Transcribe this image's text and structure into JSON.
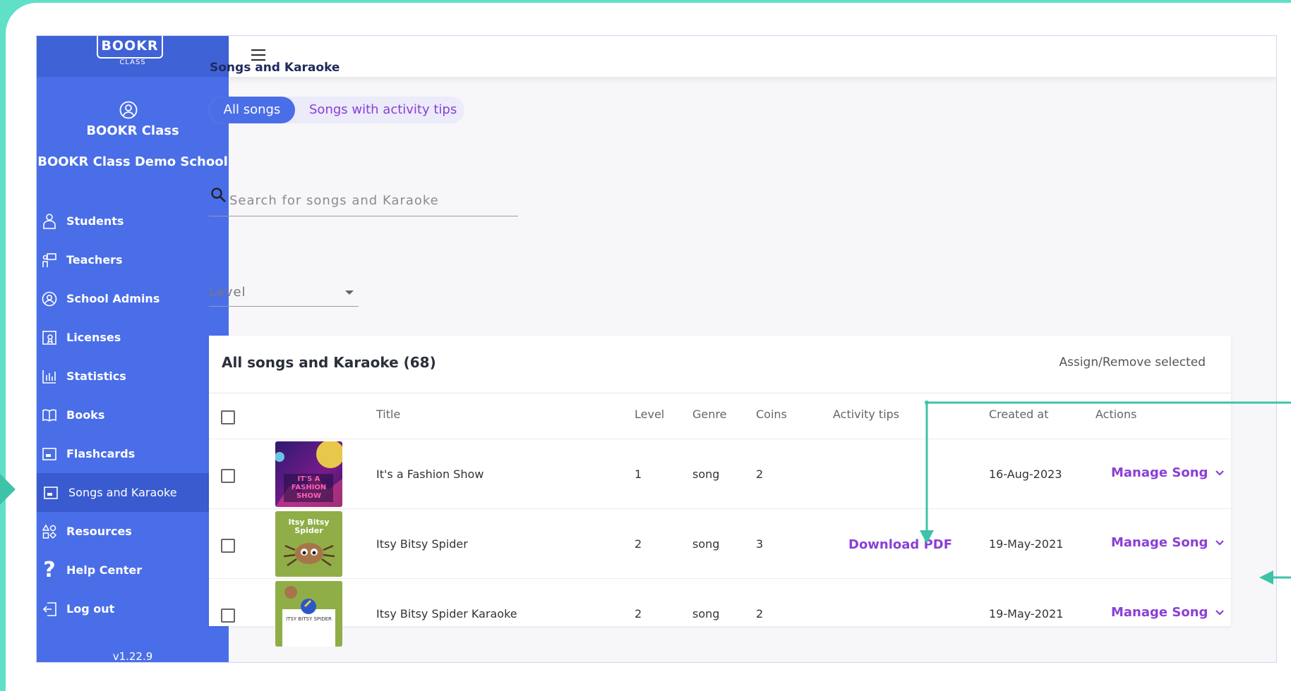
{
  "sidebar": {
    "logo": "BOOKR",
    "logo_sub": "CLASS",
    "user_name": "BOOKR Class",
    "school_name": "BOOKR Class Demo School",
    "items": [
      {
        "label": "Students",
        "icon": "students-icon"
      },
      {
        "label": "Teachers",
        "icon": "teachers-icon"
      },
      {
        "label": "School Admins",
        "icon": "admin-icon"
      },
      {
        "label": "Licenses",
        "icon": "license-icon"
      },
      {
        "label": "Statistics",
        "icon": "statistics-icon"
      },
      {
        "label": "Books",
        "icon": "book-icon"
      },
      {
        "label": "Flashcards",
        "icon": "flashcards-icon"
      },
      {
        "label": "Songs and Karaoke",
        "icon": "songs-icon"
      },
      {
        "label": "Resources",
        "icon": "resources-icon"
      },
      {
        "label": "Help Center",
        "icon": "help-icon"
      },
      {
        "label": "Log out",
        "icon": "logout-icon"
      }
    ],
    "active_index": 7,
    "version": "v1.22.9"
  },
  "page": {
    "title": "Songs and Karaoke",
    "tabs": {
      "all": "All songs",
      "tips": "Songs with activity tips"
    },
    "search_placeholder": "Search for songs and Karaoke",
    "level_label": "Level"
  },
  "table": {
    "title": "All songs and Karaoke (68)",
    "assign_label": "Assign/Remove selected",
    "headers": {
      "title": "Title",
      "level": "Level",
      "genre": "Genre",
      "coins": "Coins",
      "tips": "Activity tips",
      "created": "Created at",
      "actions": "Actions"
    },
    "rows": [
      {
        "title": "It's a Fashion Show",
        "level": "1",
        "genre": "song",
        "coins": "2",
        "tips": "",
        "created": "16-Aug-2023",
        "action": "Manage Song",
        "thumb_text": "IT'S A FASHION SHOW"
      },
      {
        "title": "Itsy Bitsy Spider",
        "level": "2",
        "genre": "song",
        "coins": "3",
        "tips": "Download PDF",
        "created": "19-May-2021",
        "action": "Manage Song",
        "thumb_text": "Itsy Bitsy Spider"
      },
      {
        "title": "Itsy Bitsy Spider Karaoke",
        "level": "2",
        "genre": "song",
        "coins": "2",
        "tips": "",
        "created": "19-May-2021",
        "action": "Manage Song",
        "thumb_text": "ITSY BITSY SPIDER"
      }
    ]
  },
  "colors": {
    "sidebar": "#4a6ee8",
    "accent": "#8a3fd6",
    "annotation": "#3fc3a8"
  }
}
